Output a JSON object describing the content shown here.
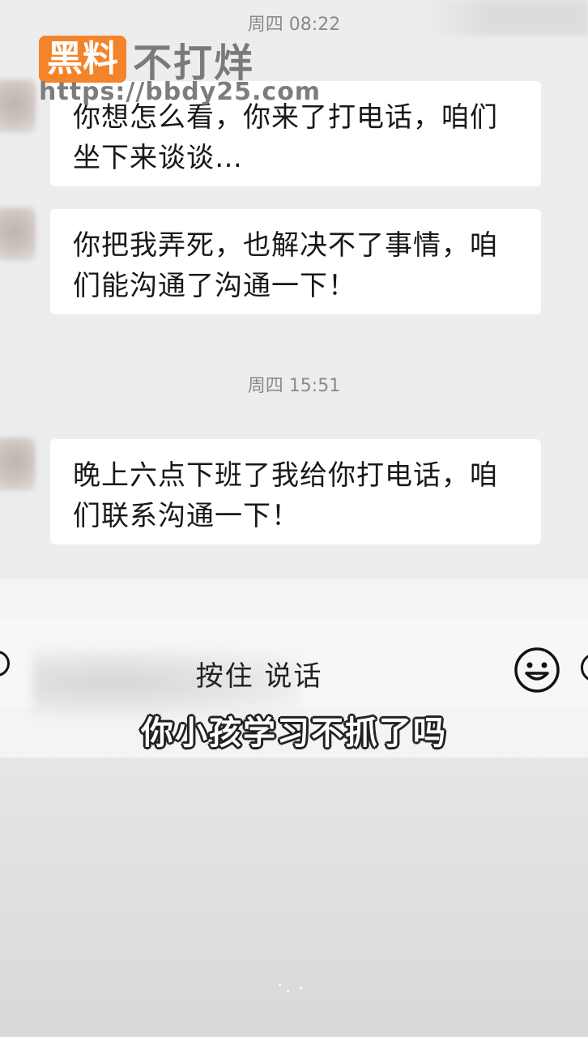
{
  "watermark": {
    "badge": "黑料",
    "tag": "不打烊",
    "url": "https://bbdy25.com"
  },
  "chat": {
    "messages": [
      {
        "timestamp": "周四 08:22",
        "lines": [
          "你想怎么看，你来了打电话，咱们",
          "坐下来谈谈…"
        ]
      },
      {
        "lines": [
          "你把我弄死，也解决不了事情，咱",
          "们能沟通了沟通一下！"
        ]
      },
      {
        "timestamp": "周四 15:51",
        "lines": [
          "晚上六点下班了我给你打电话，咱",
          "们联系沟通一下！"
        ]
      }
    ]
  },
  "input_bar": {
    "hold_to_talk_label": "按住 说话",
    "icons": [
      "voice-icon",
      "emoji-icon",
      "plus-icon"
    ]
  },
  "subtitle": "你小孩学习不抓了吗",
  "colors": {
    "background": "#ededee",
    "bubble": "#ffffff",
    "badge": "#f3842a",
    "timestamp": "#8a8a8a"
  }
}
